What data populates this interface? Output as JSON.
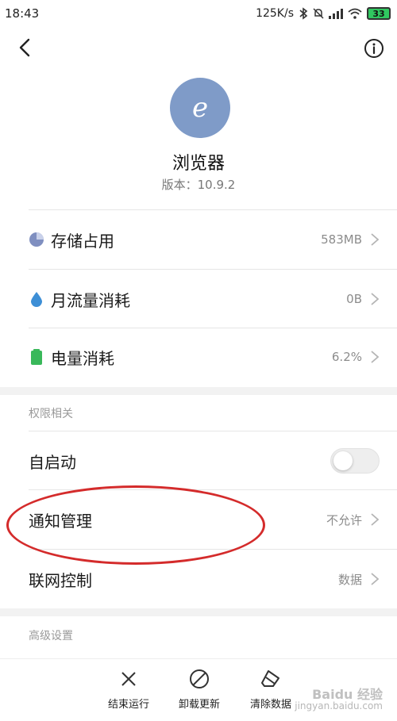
{
  "status_bar": {
    "time": "18:43",
    "net_speed": "125K/s",
    "battery": "33"
  },
  "header": {
    "back_icon": "chevron-left-icon",
    "info_icon": "info-circle-icon"
  },
  "app": {
    "logo_letter": "e",
    "name": "浏览器",
    "version": "版本：10.9.2"
  },
  "usage_rows": [
    {
      "label": "存储占用",
      "value": "583MB",
      "icon": "pie-chart-icon",
      "color": "#7f8fc0"
    },
    {
      "label": "月流量消耗",
      "value": "0B",
      "icon": "water-drop-icon",
      "color": "#3d8fd6"
    },
    {
      "label": "电量消耗",
      "value": "6.2%",
      "icon": "battery-icon",
      "color": "#39b85a"
    }
  ],
  "permissions": {
    "section_title": "权限相关",
    "autostart_label": "自启动",
    "autostart_on": false,
    "notification_label": "通知管理",
    "notification_value": "不允许",
    "network_label": "联网控制",
    "network_value": "数据"
  },
  "advanced": {
    "section_title": "高级设置"
  },
  "bottom_actions": [
    {
      "label": "结束运行",
      "icon": "close-x-icon"
    },
    {
      "label": "卸载更新",
      "icon": "prohibited-icon"
    },
    {
      "label": "清除数据",
      "icon": "eraser-icon"
    }
  ],
  "watermark": {
    "main": "Baidu 经验",
    "sub": "jingyan.baidu.com"
  },
  "colors": {
    "highlight": "#d42b2b",
    "logo_bg": "#7f9bc8",
    "battery_fill": "#30c860"
  }
}
